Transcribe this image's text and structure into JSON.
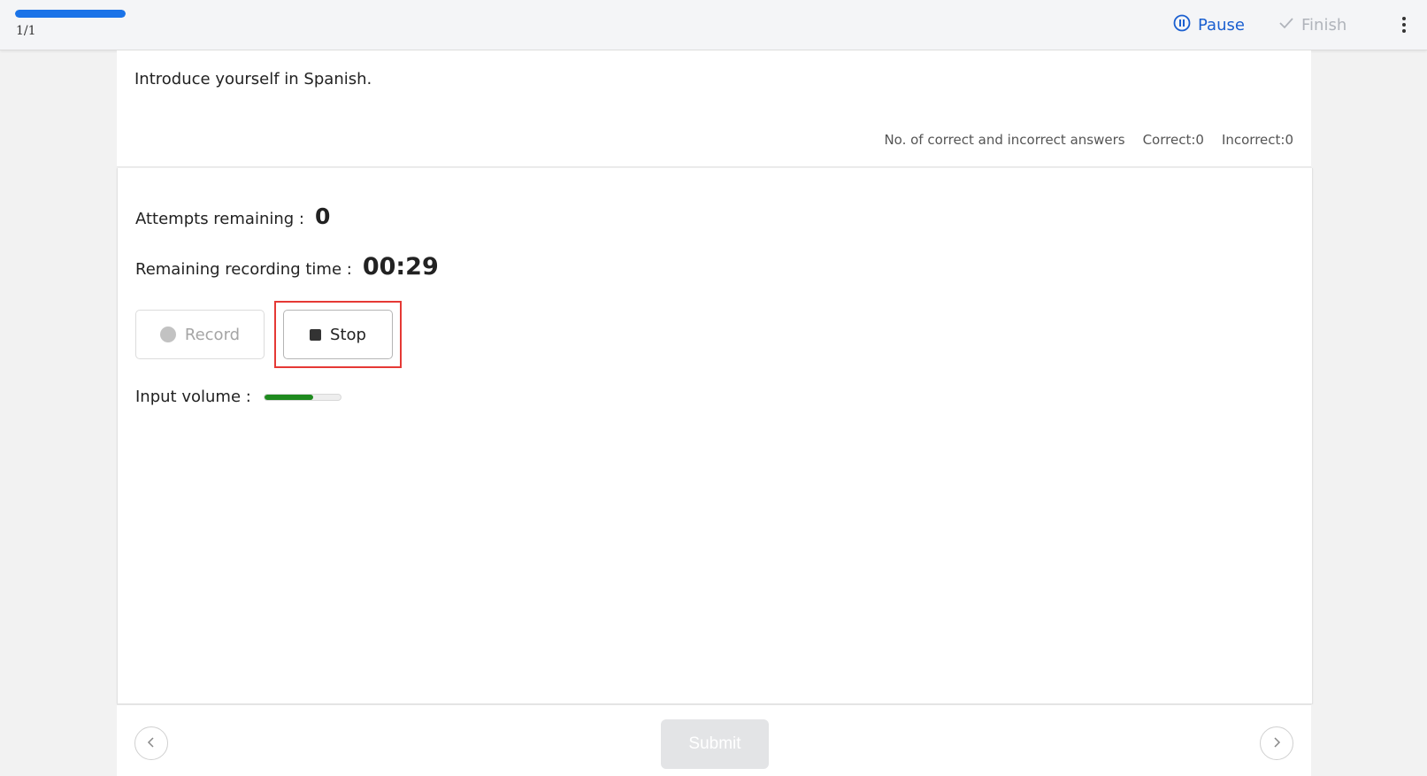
{
  "header": {
    "progress_text": "1/1",
    "progress_fraction": 1.0,
    "pause_label": "Pause",
    "finish_label": "Finish"
  },
  "question": {
    "text": "Introduce yourself in Spanish.",
    "stats_label": "No. of correct and incorrect answers",
    "correct_text": "Correct:0",
    "incorrect_text": "Incorrect:0"
  },
  "answer": {
    "attempts_label": "Attempts remaining :",
    "attempts_value": "0",
    "rectime_label": "Remaining recording time :",
    "rectime_value": "00:29",
    "record_label": "Record",
    "stop_label": "Stop",
    "volume_label": "Input volume :",
    "volume_level": 0.64
  },
  "footer": {
    "submit_label": "Submit"
  },
  "colors": {
    "accent": "#1a73e8",
    "highlight": "#e53935",
    "volume": "#1e8a1e"
  }
}
